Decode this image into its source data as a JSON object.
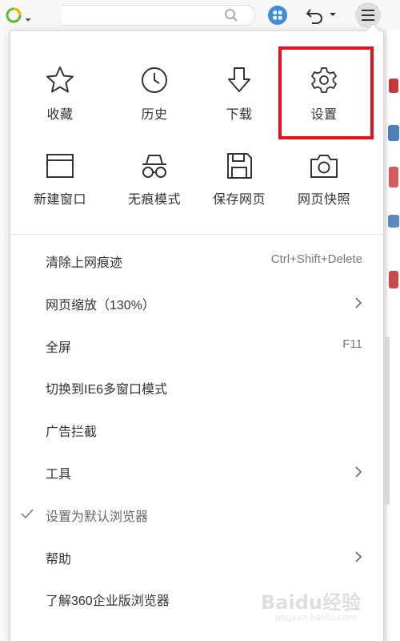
{
  "quick_actions": [
    {
      "label": "收藏",
      "icon": "star-icon"
    },
    {
      "label": "历史",
      "icon": "clock-icon"
    },
    {
      "label": "下载",
      "icon": "download-arrow-icon"
    },
    {
      "label": "设置",
      "icon": "gear-icon",
      "highlighted": true
    },
    {
      "label": "新建窗口",
      "icon": "window-icon"
    },
    {
      "label": "无痕模式",
      "icon": "incognito-icon"
    },
    {
      "label": "保存网页",
      "icon": "floppy-disk-icon"
    },
    {
      "label": "网页快照",
      "icon": "camera-icon"
    }
  ],
  "menu_items": [
    {
      "label": "清除上网痕迹",
      "shortcut": "Ctrl+Shift+Delete"
    },
    {
      "label": "网页缩放（130%）",
      "submenu": true
    },
    {
      "label": "全屏",
      "shortcut": "F11"
    },
    {
      "label": "切换到IE6多窗口模式"
    },
    {
      "label": "广告拦截"
    },
    {
      "label": "工具",
      "submenu": true
    },
    {
      "label": "设置为默认浏览器",
      "checked": true
    },
    {
      "label": "帮助",
      "submenu": true
    },
    {
      "label": "了解360企业版浏览器"
    }
  ],
  "watermark": {
    "text": "Baidu经验",
    "sub": "jingyan.baidu.com"
  },
  "colors": {
    "highlight": "#e3121a",
    "logo_green": "#5dbb2a",
    "logo_yellow": "#f6b400",
    "apps_blue": "#3f8de0",
    "text": "#333333"
  }
}
